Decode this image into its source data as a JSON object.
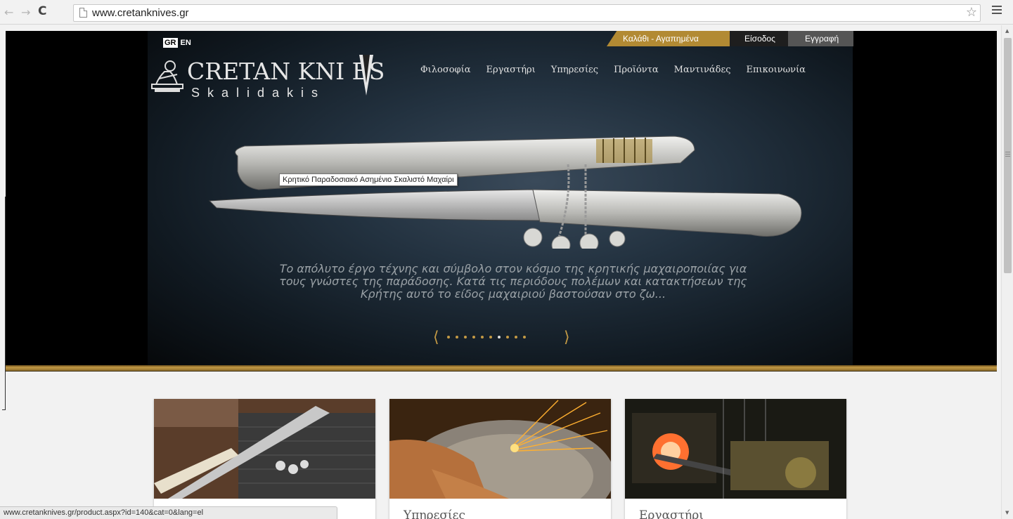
{
  "browser": {
    "url": "www.cretanknives.gr",
    "status_url": "www.cretanknives.gr/product.aspx?id=140&cat=0&lang=el"
  },
  "lang": {
    "gr": "GR",
    "en": "EN"
  },
  "top_links": {
    "cart": "Καλάθι - Αγαπημένα",
    "login": "Είσοδος",
    "register": "Εγγραφή"
  },
  "logo": {
    "title": "CRETAN KNI  ES",
    "subtitle": "Skalidakis"
  },
  "nav": [
    {
      "label": "Φιλοσοφία"
    },
    {
      "label": "Εργαστήρι"
    },
    {
      "label": "Υπηρεσίες"
    },
    {
      "label": "Προϊόντα"
    },
    {
      "label": "Μαντινάδες"
    },
    {
      "label": "Επικοινωνία"
    }
  ],
  "slider": {
    "tooltip": "Κρητικό Παραδοσιακό Ασημένιο Σκαλιστό Μαχαίρι",
    "caption": "Το απόλυτο έργο τέχνης και σύμβολο στον κόσμο της κρητικής μαχαιροποιίας για τους γνώστες της παράδοσης. Κατά τις περιόδους πολέμων και κατακτήσεων της Κρήτης αυτό το είδος μαχαιριού βαστούσαν στο ζω...",
    "dot_count": 10,
    "active_dot": 6
  },
  "cards": [
    {
      "title": ""
    },
    {
      "title": "Υπηρεσίες"
    },
    {
      "title": "Εργαστήρι"
    }
  ],
  "colors": {
    "gold": "#c49a45",
    "cart_bg": "#b28a33"
  }
}
